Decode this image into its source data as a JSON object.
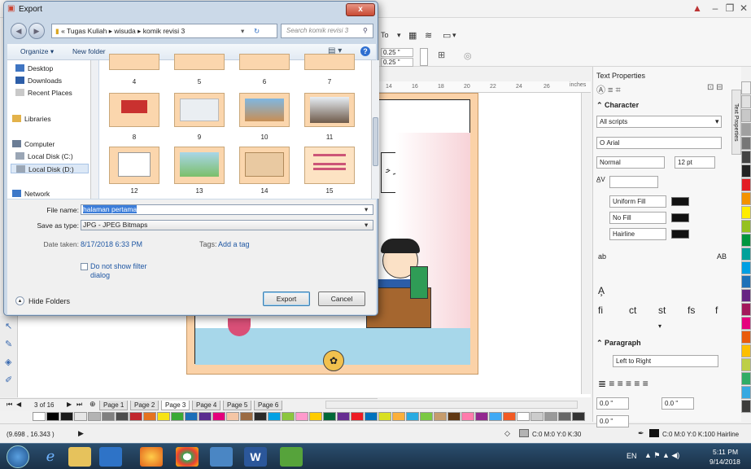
{
  "app": {
    "propbar": {
      "to_label": "To",
      "nudge1": "0.25 \"",
      "nudge2": "0.25 \""
    },
    "ruler": {
      "ticks": [
        "14",
        "16",
        "18",
        "20",
        "22",
        "24",
        "26"
      ],
      "unit": "inches"
    },
    "page_tabs": {
      "counter": "3 of 16",
      "tabs": [
        "Page 1",
        "Page 2",
        "Page 3",
        "Page 4",
        "Page 5",
        "Page 6"
      ],
      "active": "Page 3"
    },
    "status": {
      "coords": "(9.698 , 16.343 )",
      "fill_label": "C:0 M:0 Y:0 K:30",
      "outline_label": "C:0 M:0 Y:0 K:100 Hairline"
    },
    "canvas": {
      "arabic_text": "ﺒﺬﻛﺮ ﺧ"
    },
    "colors": {
      "page_bg": "#fbd2a8",
      "accent": "#3c7dd9"
    }
  },
  "docker": {
    "title": "Text Properties",
    "vertical_tab": "Text Properties",
    "character_header": "Character",
    "script_select": "All scripts",
    "font_select": "Arial",
    "style_select": "Normal",
    "size_select": "12 pt",
    "fill_select": "Uniform Fill",
    "bg_select": "No Fill",
    "outline_select": "Hairline",
    "paragraph_header": "Paragraph",
    "direction_select": "Left to Right",
    "spacing1": "0.0 \"",
    "spacing2": "0.0 \"",
    "spacing3": "0.0 \"",
    "ab_label": "ab",
    "ab2_label": "AB",
    "fi_label": "fi",
    "ct_label": "ct",
    "st_label": "st",
    "fs_label": "fs",
    "f_label": "f"
  },
  "dialog": {
    "title": "Export",
    "close_label": "x",
    "breadcrumb": [
      "Tugas Kuliah",
      "wisuda",
      "komik revisi 3"
    ],
    "breadcrumb_prefix": "«",
    "search_placeholder": "Search komik revisi 3",
    "organize_label": "Organize ▾",
    "new_folder_label": "New folder",
    "nav": {
      "desktop": "Desktop",
      "downloads": "Downloads",
      "recent": "Recent Places",
      "libraries": "Libraries",
      "computer": "Computer",
      "disk_c": "Local Disk (C:)",
      "disk_d": "Local Disk (D:)",
      "network": "Network"
    },
    "thumbnails": [
      "4",
      "5",
      "6",
      "7",
      "8",
      "9",
      "10",
      "11",
      "12",
      "13",
      "14",
      "15"
    ],
    "file_name_label": "File name:",
    "file_name_value": "halaman pertama",
    "save_type_label": "Save as type:",
    "save_type_value": "JPG - JPEG Bitmaps",
    "date_taken_label": "Date taken:",
    "date_taken_value": "8/17/2018 6:33 PM",
    "tags_label": "Tags:",
    "tags_value": "Add a tag",
    "filter_checkbox_label": "Do not show filter dialog",
    "hide_folders_label": "Hide Folders",
    "export_button": "Export",
    "cancel_button": "Cancel"
  },
  "taskbar": {
    "lang": "EN",
    "time": "5:11 PM",
    "date": "9/14/2018"
  }
}
